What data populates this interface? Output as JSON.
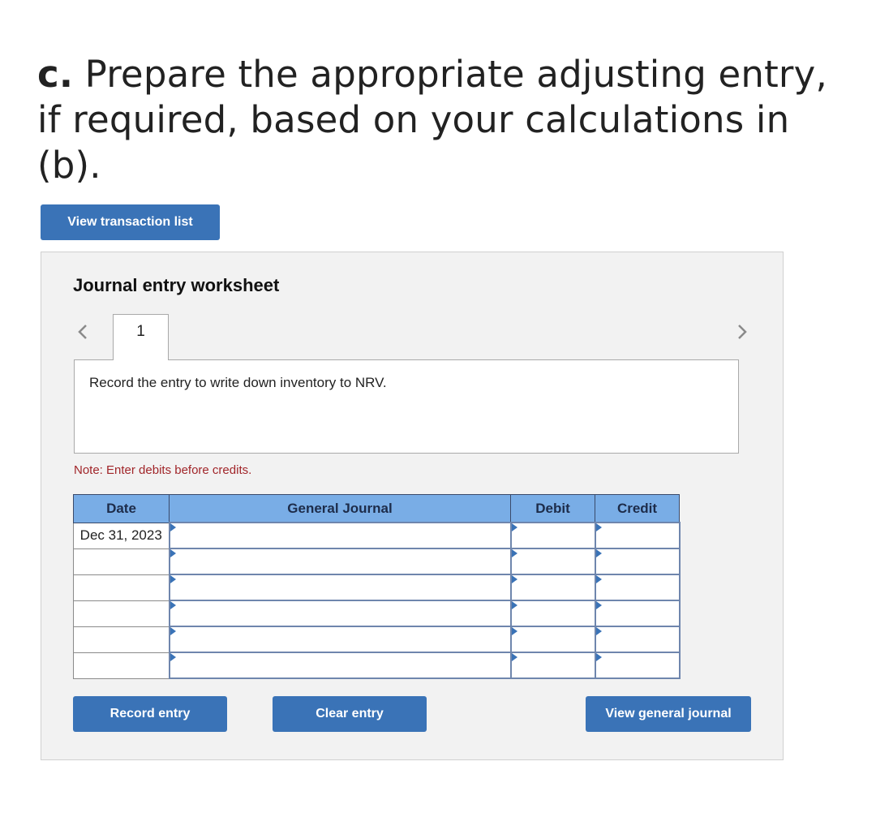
{
  "question": {
    "label": "c.",
    "text": " Prepare the appropriate adjusting entry, if required, based on your calculations in (b)."
  },
  "buttons": {
    "view_transaction_list": "View transaction list",
    "record_entry": "Record entry",
    "clear_entry": "Clear entry",
    "view_general_journal": "View general journal"
  },
  "worksheet": {
    "title": "Journal entry worksheet",
    "nav_prev_icon": "chevron-left-icon",
    "nav_next_icon": "chevron-right-icon",
    "tabs": [
      {
        "label": "1",
        "active": true
      }
    ],
    "prompt": "Record the entry to write down inventory to NRV.",
    "note": "Note: Enter debits before credits."
  },
  "journal": {
    "headers": {
      "date": "Date",
      "general_journal": "General Journal",
      "debit": "Debit",
      "credit": "Credit"
    },
    "rows": [
      {
        "date": "Dec 31, 2023",
        "account": "",
        "debit": "",
        "credit": ""
      },
      {
        "date": "",
        "account": "",
        "debit": "",
        "credit": ""
      },
      {
        "date": "",
        "account": "",
        "debit": "",
        "credit": ""
      },
      {
        "date": "",
        "account": "",
        "debit": "",
        "credit": ""
      },
      {
        "date": "",
        "account": "",
        "debit": "",
        "credit": ""
      },
      {
        "date": "",
        "account": "",
        "debit": "",
        "credit": ""
      }
    ]
  },
  "colors": {
    "button_bg": "#3a73b7",
    "header_bg": "#79ade6",
    "note_text": "#a1262a",
    "panel_bg": "#f2f2f2"
  }
}
